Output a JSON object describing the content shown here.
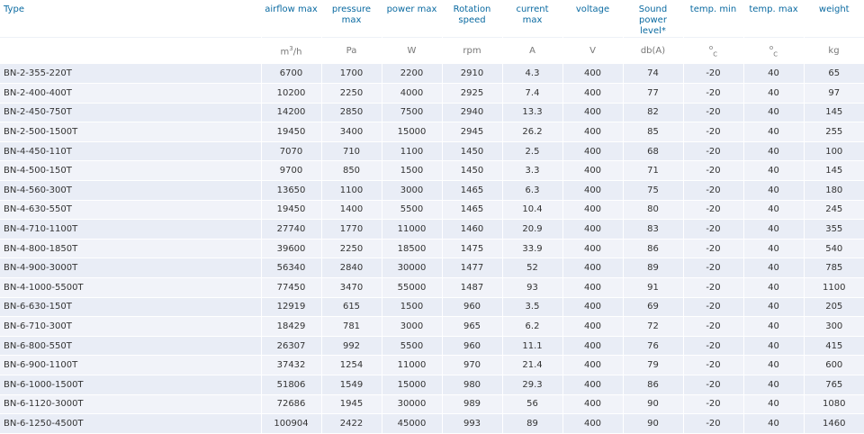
{
  "headers": [
    "Type",
    "airflow max",
    "pressure max",
    "power max",
    "Rotation speed",
    "current max",
    "voltage",
    "Sound power level*",
    "temp. min",
    "temp. max",
    "weight"
  ],
  "units": {
    "airflow": {
      "base": "m",
      "sup": "3",
      "tail": "/h"
    },
    "pressure": "Pa",
    "power": "W",
    "rotation": "rpm",
    "current": "A",
    "voltage": "V",
    "sound": "db(A)",
    "temp_min": {
      "base": "o",
      "sub": "C"
    },
    "temp_max": {
      "base": "o",
      "sub": "C"
    },
    "weight": "kg"
  },
  "rows": [
    [
      "BN-2-355-220T",
      "6700",
      "1700",
      "2200",
      "2910",
      "4.3",
      "400",
      "74",
      "-20",
      "40",
      "65"
    ],
    [
      "BN-2-400-400T",
      "10200",
      "2250",
      "4000",
      "2925",
      "7.4",
      "400",
      "77",
      "-20",
      "40",
      "97"
    ],
    [
      "BN-2-450-750T",
      "14200",
      "2850",
      "7500",
      "2940",
      "13.3",
      "400",
      "82",
      "-20",
      "40",
      "145"
    ],
    [
      "BN-2-500-1500T",
      "19450",
      "3400",
      "15000",
      "2945",
      "26.2",
      "400",
      "85",
      "-20",
      "40",
      "255"
    ],
    [
      "BN-4-450-110T",
      "7070",
      "710",
      "1100",
      "1450",
      "2.5",
      "400",
      "68",
      "-20",
      "40",
      "100"
    ],
    [
      "BN-4-500-150T",
      "9700",
      "850",
      "1500",
      "1450",
      "3.3",
      "400",
      "71",
      "-20",
      "40",
      "145"
    ],
    [
      "BN-4-560-300T",
      "13650",
      "1100",
      "3000",
      "1465",
      "6.3",
      "400",
      "75",
      "-20",
      "40",
      "180"
    ],
    [
      "BN-4-630-550T",
      "19450",
      "1400",
      "5500",
      "1465",
      "10.4",
      "400",
      "80",
      "-20",
      "40",
      "245"
    ],
    [
      "BN-4-710-1100T",
      "27740",
      "1770",
      "11000",
      "1460",
      "20.9",
      "400",
      "83",
      "-20",
      "40",
      "355"
    ],
    [
      "BN-4-800-1850T",
      "39600",
      "2250",
      "18500",
      "1475",
      "33.9",
      "400",
      "86",
      "-20",
      "40",
      "540"
    ],
    [
      "BN-4-900-3000T",
      "56340",
      "2840",
      "30000",
      "1477",
      "52",
      "400",
      "89",
      "-20",
      "40",
      "785"
    ],
    [
      "BN-4-1000-5500T",
      "77450",
      "3470",
      "55000",
      "1487",
      "93",
      "400",
      "91",
      "-20",
      "40",
      "1100"
    ],
    [
      "BN-6-630-150T",
      "12919",
      "615",
      "1500",
      "960",
      "3.5",
      "400",
      "69",
      "-20",
      "40",
      "205"
    ],
    [
      "BN-6-710-300T",
      "18429",
      "781",
      "3000",
      "965",
      "6.2",
      "400",
      "72",
      "-20",
      "40",
      "300"
    ],
    [
      "BN-6-800-550T",
      "26307",
      "992",
      "5500",
      "960",
      "11.1",
      "400",
      "76",
      "-20",
      "40",
      "415"
    ],
    [
      "BN-6-900-1100T",
      "37432",
      "1254",
      "11000",
      "970",
      "21.4",
      "400",
      "79",
      "-20",
      "40",
      "600"
    ],
    [
      "BN-6-1000-1500T",
      "51806",
      "1549",
      "15000",
      "980",
      "29.3",
      "400",
      "86",
      "-20",
      "40",
      "765"
    ],
    [
      "BN-6-1120-3000T",
      "72686",
      "1945",
      "30000",
      "989",
      "56",
      "400",
      "90",
      "-20",
      "40",
      "1080"
    ],
    [
      "BN-6-1250-4500T",
      "100904",
      "2422",
      "45000",
      "993",
      "89",
      "400",
      "90",
      "-20",
      "40",
      "1460"
    ]
  ]
}
